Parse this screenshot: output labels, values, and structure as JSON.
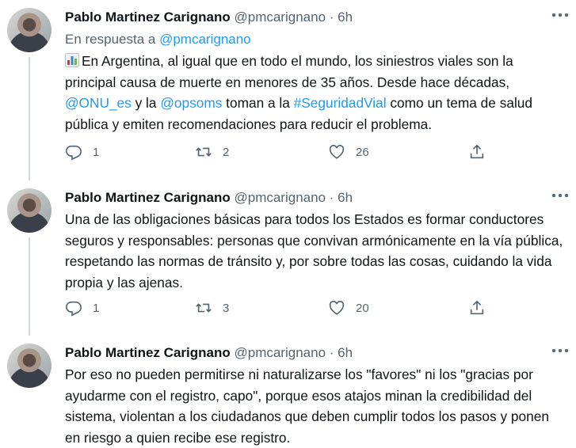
{
  "tweets": [
    {
      "name": "Pablo Martinez Carignano",
      "handle": "@pmcarignano",
      "separator": "·",
      "time": "6h",
      "reply_prefix": "En respuesta a",
      "reply_handle": "@pmcarignano",
      "text": {
        "t1": "En Argentina, al igual que en todo el mundo, los siniestros viales son la principal causa de muerte en menores de 35 años. Desde hace décadas, ",
        "m1": "@ONU_es",
        "t2": " y la ",
        "m2": "@opsoms",
        "t3": " toman a la ",
        "h1": "#SeguridadVial",
        "t4": " como un tema  de salud pública y emiten recomendaciones para reducir el problema."
      },
      "replies": "1",
      "retweets": "2",
      "likes": "26"
    },
    {
      "name": "Pablo Martinez Carignano",
      "handle": "@pmcarignano",
      "separator": "·",
      "time": "6h",
      "text": "Una de las obligaciones básicas para todos los Estados es formar conductores seguros y responsables: personas que convivan armónicamente en la vía pública, respetando las normas de tránsito y, por sobre todas las cosas, cuidando la vida propia y las ajenas.",
      "replies": "1",
      "retweets": "3",
      "likes": "20"
    },
    {
      "name": "Pablo Martinez Carignano",
      "handle": "@pmcarignano",
      "separator": "·",
      "time": "6h",
      "text": "Por eso no pueden permitirse ni naturalizarse los \"favores\" ni los \"gracias por ayudarme con el registro, capo\", porque esos atajos minan la credibilidad del sistema, violentan a los ciudadanos que deben cumplir todos los pasos y ponen en riesgo a quien recibe ese registro."
    }
  ],
  "icons": {
    "reply": "reply-icon",
    "retweet": "retweet-icon",
    "like": "heart-icon",
    "share": "share-icon",
    "more": "more-icon",
    "chart_emoji": "bar-chart-emoji"
  },
  "colors": {
    "link": "#1d9bf0",
    "secondary": "#536471",
    "text": "#0f1419",
    "line": "#cfd9de"
  }
}
